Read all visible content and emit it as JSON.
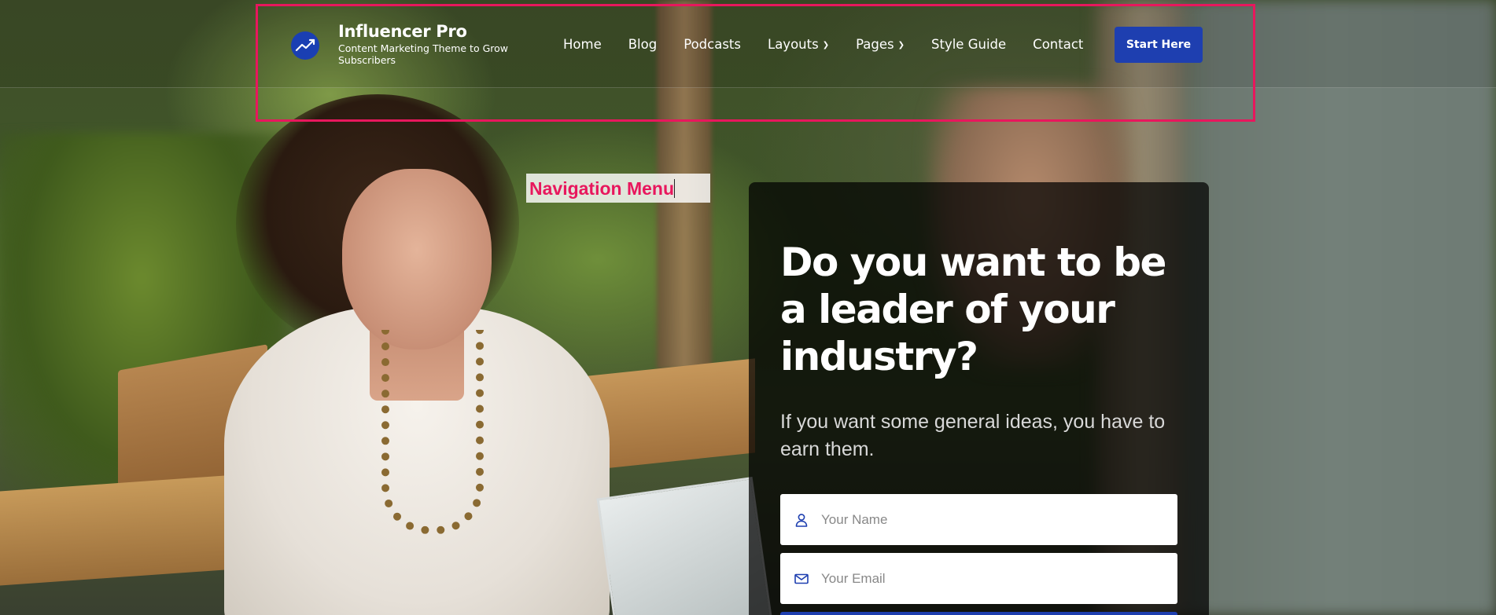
{
  "header": {
    "site_title": "Influencer Pro",
    "tagline": "Content Marketing Theme to Grow Subscribers",
    "logo_icon": "trend-up-icon",
    "nav": [
      {
        "label": "Home",
        "has_dropdown": false
      },
      {
        "label": "Blog",
        "has_dropdown": false
      },
      {
        "label": "Podcasts",
        "has_dropdown": false
      },
      {
        "label": "Layouts",
        "has_dropdown": true
      },
      {
        "label": "Pages",
        "has_dropdown": true
      },
      {
        "label": "Style Guide",
        "has_dropdown": false
      },
      {
        "label": "Contact",
        "has_dropdown": false
      }
    ],
    "cta_label": "Start Here"
  },
  "annotation": {
    "label": "Navigation Menu",
    "color": "#e8175d"
  },
  "hero": {
    "title": "Do you want to be a leader of your industry?",
    "subtitle": "If you want some general ideas, you have to earn them.",
    "name_placeholder": "Your Name",
    "email_placeholder": "Your Email"
  },
  "colors": {
    "accent": "#1e3fb0",
    "annotation": "#e8175d"
  }
}
